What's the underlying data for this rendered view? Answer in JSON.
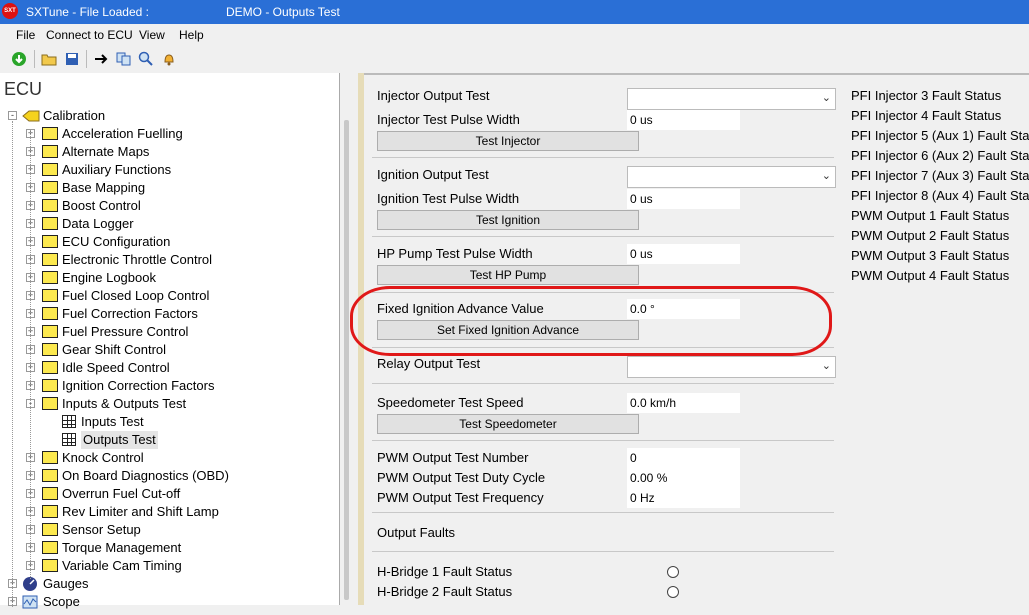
{
  "window": {
    "app_title": "SXTune - File Loaded :",
    "doc_title": "DEMO - Outputs Test",
    "logo_text": "SXT"
  },
  "menu": [
    "File",
    "Connect to ECU",
    "View",
    "Help"
  ],
  "toolbar_icons": [
    "download-icon",
    "open-folder-icon",
    "save-icon",
    "arrow-right-icon",
    "copy-icon",
    "search-icon",
    "bell-icon"
  ],
  "left": {
    "header": "ECU",
    "calibration_label": "Calibration",
    "tree_items": [
      "Acceleration Fuelling",
      "Alternate Maps",
      "Auxiliary Functions",
      "Base Mapping",
      "Boost Control",
      "Data Logger",
      "ECU Configuration",
      "Electronic Throttle Control",
      "Engine Logbook",
      "Fuel Closed Loop Control",
      "Fuel Correction Factors",
      "Fuel Pressure Control",
      "Gear Shift Control",
      "Idle Speed Control",
      "Ignition Correction Factors",
      "Inputs & Outputs Test"
    ],
    "io_children": [
      "Inputs Test",
      "Outputs Test"
    ],
    "tree_items_after": [
      "Knock Control",
      "On Board Diagnostics (OBD)",
      "Overrun Fuel Cut-off",
      "Rev Limiter and Shift Lamp",
      "Sensor Setup",
      "Torque Management",
      "Variable Cam Timing"
    ],
    "gauges_label": "Gauges",
    "scope_label": "Scope"
  },
  "main": {
    "injector_output_test": "Injector Output Test",
    "injector_pulse_width_label": "Injector Test Pulse Width",
    "injector_pulse_width_value": "0 us",
    "test_injector_button": "Test Injector",
    "ignition_output_test": "Ignition Output Test",
    "ignition_pulse_width_label": "Ignition Test Pulse Width",
    "ignition_pulse_width_value": "0 us",
    "test_ignition_button": "Test Ignition",
    "hp_pump_pulse_width_label": "HP Pump Test Pulse Width",
    "hp_pump_pulse_width_value": "0 us",
    "test_hp_pump_button": "Test HP Pump",
    "fixed_ign_label": "Fixed Ignition Advance Value",
    "fixed_ign_value": "0.0 °",
    "set_fixed_ign_button": "Set Fixed Ignition Advance",
    "relay_output_test": "Relay Output Test",
    "speedo_label": "Speedometer Test Speed",
    "speedo_value": "0.0 km/h",
    "test_speedo_button": "Test Speedometer",
    "pwm_number_label": "PWM Output Test Number",
    "pwm_number_value": "0",
    "pwm_duty_label": "PWM Output Test Duty Cycle",
    "pwm_duty_value": "0.00 %",
    "pwm_freq_label": "PWM Output Test Frequency",
    "pwm_freq_value": "0 Hz",
    "output_faults": "Output Faults",
    "hbridge1": "H-Bridge 1 Fault Status",
    "hbridge2": "H-Bridge 2 Fault Status"
  },
  "faults": [
    "PFI Injector 3 Fault Status",
    "PFI Injector 4 Fault Status",
    "PFI Injector 5 (Aux 1) Fault Sta",
    "PFI Injector 6 (Aux 2) Fault Sta",
    "PFI Injector 7 (Aux 3) Fault Sta",
    "PFI Injector 8 (Aux 4) Fault Sta",
    "PWM Output 1 Fault Status",
    "PWM Output 2 Fault Status",
    "PWM Output 3 Fault Status",
    "PWM Output 4 Fault Status"
  ],
  "colors": {
    "titlebar": "#2a6fd6",
    "highlight": "#e01818",
    "folder": "#fce94f"
  }
}
